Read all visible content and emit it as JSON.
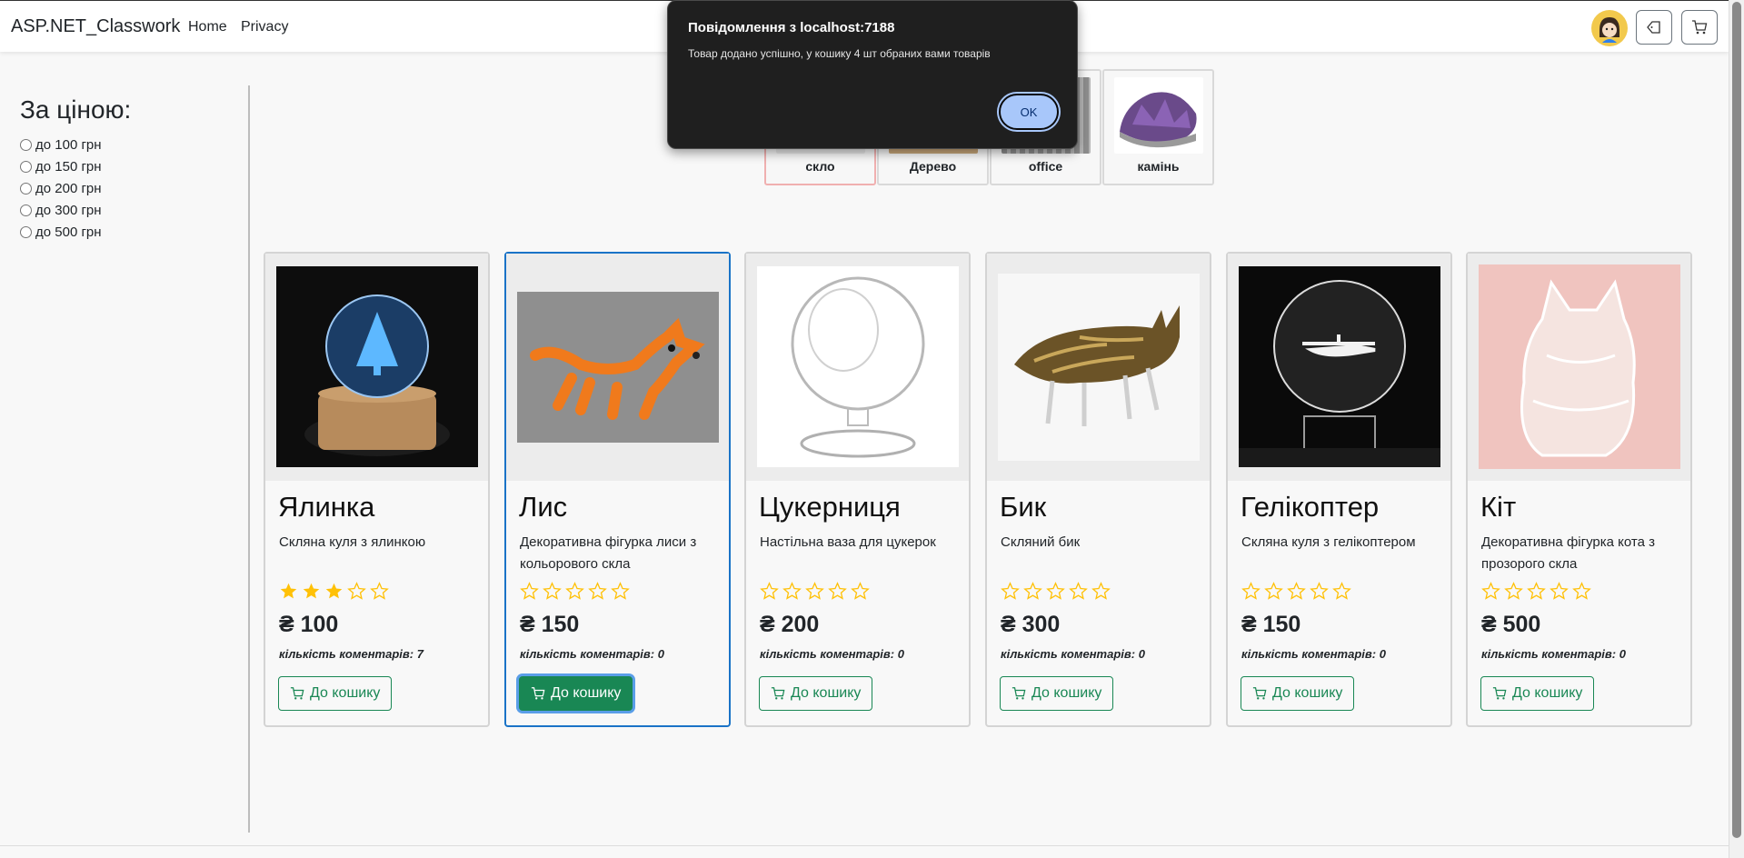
{
  "navbar": {
    "brand": "ASP.NET_Classwork",
    "links": [
      "Home",
      "Privacy"
    ]
  },
  "filter": {
    "title": "За ціною:",
    "options": [
      "до 100 грн",
      "до 150 грн",
      "до 200 грн",
      "до 300 грн",
      "до 500 грн"
    ]
  },
  "categories": [
    {
      "label": "скло",
      "active": true
    },
    {
      "label": "Дерево",
      "active": false
    },
    {
      "label": "office",
      "active": false
    },
    {
      "label": "камінь",
      "active": false
    }
  ],
  "products": [
    {
      "name": "Ялинка",
      "desc": "Скляна куля з ялинкою",
      "rating": 3,
      "price": "₴ 100",
      "comments": "кількість коментарів: 7",
      "button": "До кошику"
    },
    {
      "name": "Лис",
      "desc": "Декоративна фігурка лиси з кольорового скла",
      "rating": 0,
      "price": "₴ 150",
      "comments": "кількість коментарів: 0",
      "button": "До кошику"
    },
    {
      "name": "Цукерниця",
      "desc": "Настільна ваза для цукерок",
      "rating": 0,
      "price": "₴ 200",
      "comments": "кількість коментарів: 0",
      "button": "До кошику"
    },
    {
      "name": "Бик",
      "desc": "Скляний бик",
      "rating": 0,
      "price": "₴ 300",
      "comments": "кількість коментарів: 0",
      "button": "До кошику"
    },
    {
      "name": "Гелікоптер",
      "desc": "Скляна куля з гелікоптером",
      "rating": 0,
      "price": "₴ 150",
      "comments": "кількість коментарів: 0",
      "button": "До кошику"
    },
    {
      "name": "Кіт",
      "desc": "Декоративна фігурка кота з прозорого скла",
      "rating": 0,
      "price": "₴ 500",
      "comments": "кількість коментарів: 0",
      "button": "До кошику"
    }
  ],
  "alert": {
    "title": "Повідомлення з localhost:7188",
    "message": "Товар додано успішно, у кошику 4 шт обраних вами товарів",
    "ok": "OK"
  },
  "colors": {
    "accent_green": "#198754",
    "star_gold": "#ffc107",
    "selected_border": "#1a73c7"
  }
}
